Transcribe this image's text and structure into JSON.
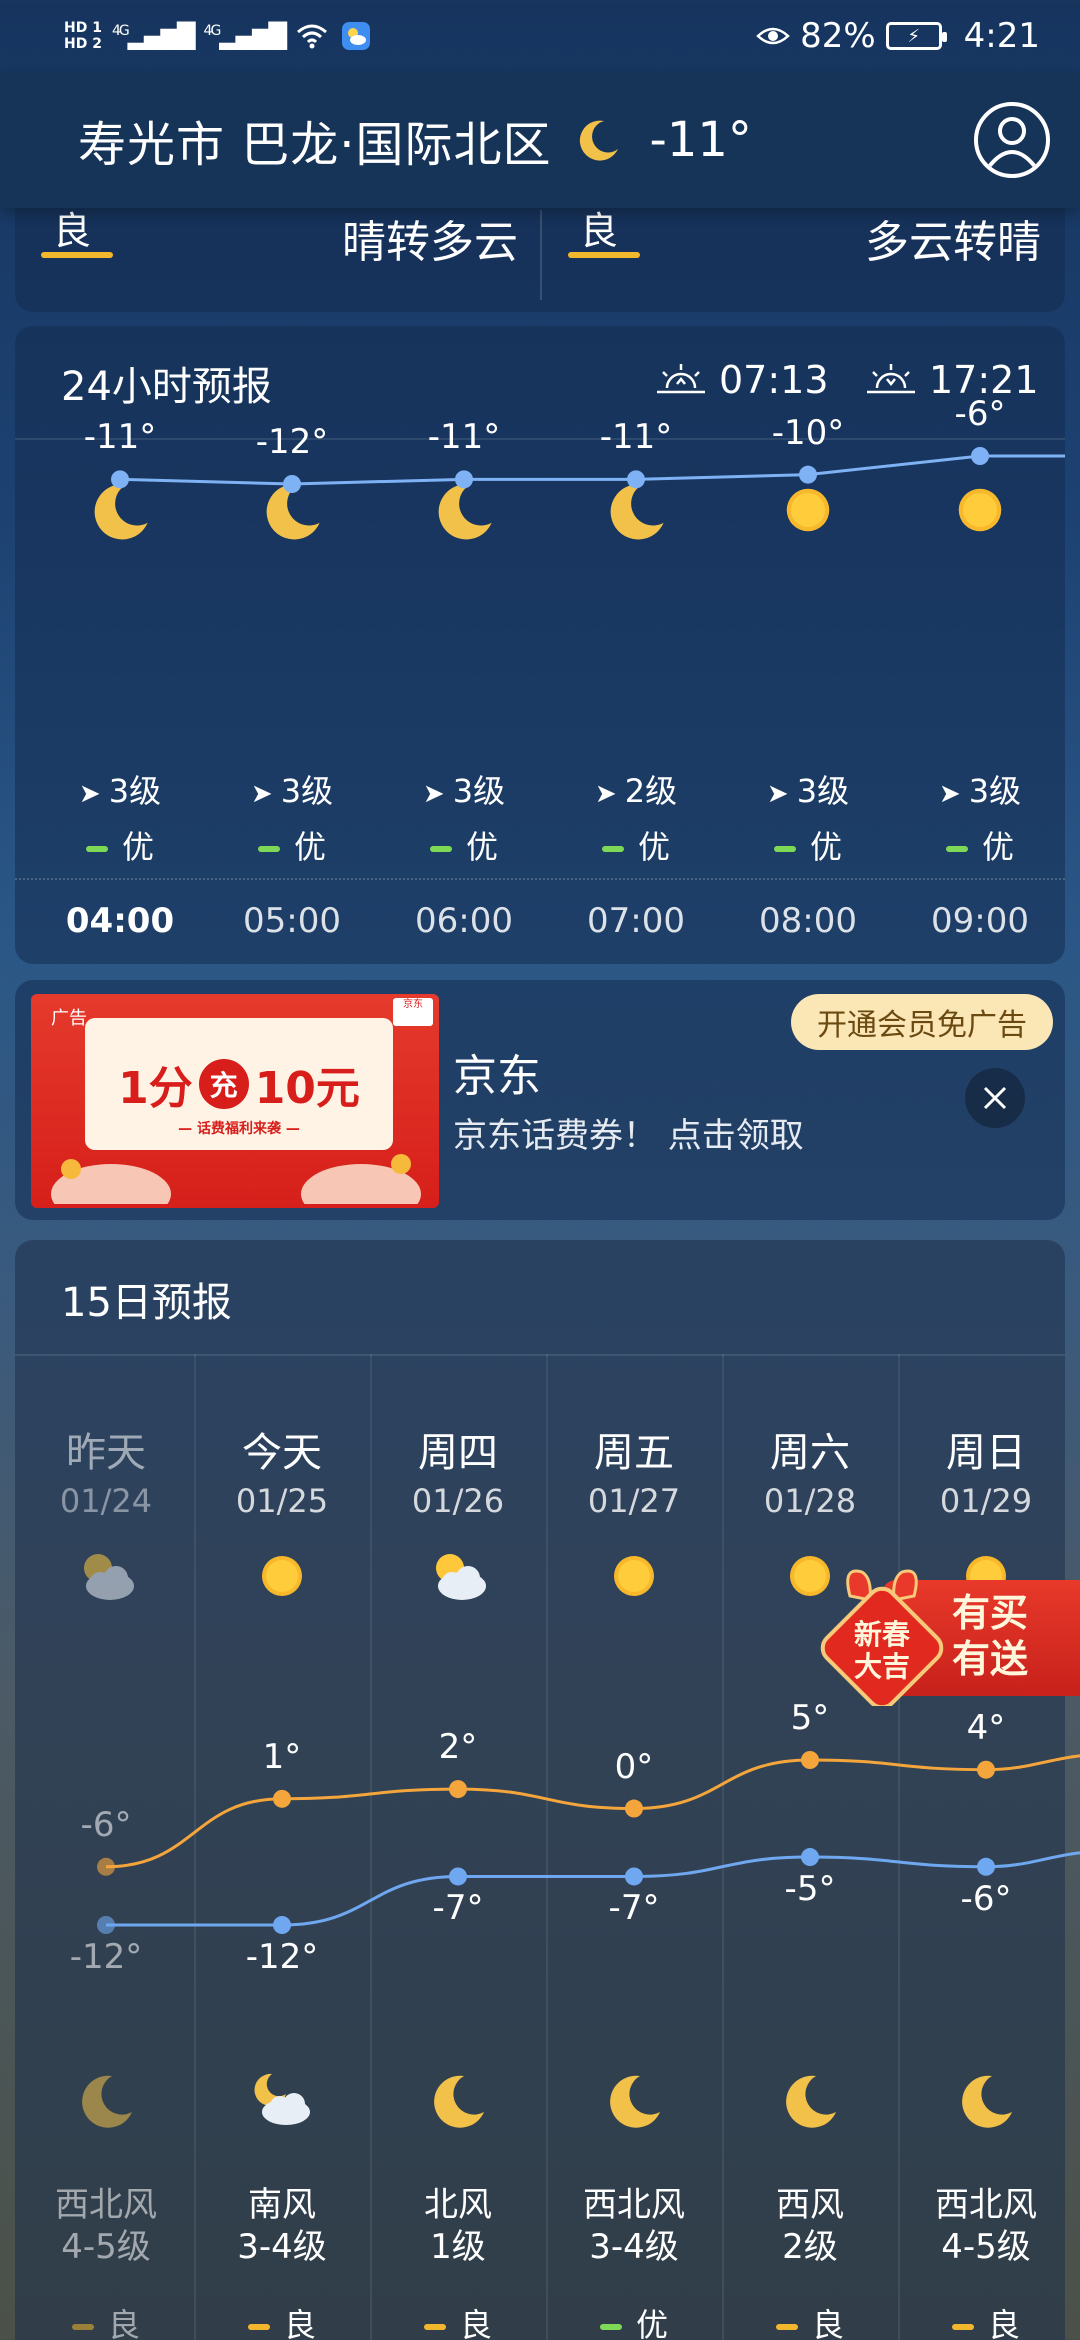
{
  "status_bar": {
    "hd1": "HD 1",
    "hd2": "HD 2",
    "net1": "4G",
    "net2": "4G",
    "battery_percent": "82%",
    "time": "4:21"
  },
  "header": {
    "location": "寿光市 巴龙·国际北区",
    "current_temp": "-11°",
    "icon": "moon-icon"
  },
  "top_card": {
    "left": {
      "aqi": "良",
      "condition": "晴转多云"
    },
    "right": {
      "aqi": "良",
      "condition": "多云转晴"
    }
  },
  "hourly": {
    "title": "24小时预报",
    "sunrise": "07:13",
    "sunset": "17:21",
    "hours": [
      {
        "time": "04:00",
        "icon": "moon-icon",
        "temp": "-11°",
        "wind": "3级",
        "aqi": "优",
        "current": true
      },
      {
        "time": "05:00",
        "icon": "moon-icon",
        "temp": "-12°",
        "wind": "3级",
        "aqi": "优"
      },
      {
        "time": "06:00",
        "icon": "moon-icon",
        "temp": "-11°",
        "wind": "3级",
        "aqi": "优"
      },
      {
        "time": "07:00",
        "icon": "moon-icon",
        "temp": "-11°",
        "wind": "2级",
        "aqi": "优"
      },
      {
        "time": "08:00",
        "icon": "sun-icon",
        "temp": "-10°",
        "wind": "3级",
        "aqi": "优"
      },
      {
        "time": "09:00",
        "icon": "sun-icon",
        "temp": "-6°",
        "wind": "3级",
        "aqi": "优"
      }
    ]
  },
  "ad": {
    "brand": "京东",
    "description": "京东话费券！ 点击领取",
    "vip_button": "开通会员免广告",
    "image_text_a": "1分",
    "image_text_b": "充",
    "image_text_c": "10元",
    "image_sub": "— 话费福利来袭 —",
    "image_logo": "广告",
    "image_jd": "京东"
  },
  "daily": {
    "title": "15日预报",
    "days": [
      {
        "day": "昨天",
        "date": "01/24",
        "day_icon": "partly-cloudy-icon",
        "high": "-6°",
        "low": "-12°",
        "night_icon": "moon-icon",
        "wind_dir": "西北风",
        "wind_level": "4-5级",
        "aqi": "良",
        "past": true
      },
      {
        "day": "今天",
        "date": "01/25",
        "day_icon": "sun-icon",
        "high": "1°",
        "low": "-12°",
        "night_icon": "moon-cloud-icon",
        "wind_dir": "南风",
        "wind_level": "3-4级",
        "aqi": "良"
      },
      {
        "day": "周四",
        "date": "01/26",
        "day_icon": "partly-cloudy-icon",
        "high": "2°",
        "low": "-7°",
        "night_icon": "moon-icon",
        "wind_dir": "北风",
        "wind_level": "1级",
        "aqi": "良"
      },
      {
        "day": "周五",
        "date": "01/27",
        "day_icon": "sun-icon",
        "high": "0°",
        "low": "-7°",
        "night_icon": "moon-icon",
        "wind_dir": "西北风",
        "wind_level": "3-4级",
        "aqi": "优"
      },
      {
        "day": "周六",
        "date": "01/28",
        "day_icon": "sun-icon",
        "high": "5°",
        "low": "-5°",
        "night_icon": "moon-icon",
        "wind_dir": "西风",
        "wind_level": "2级",
        "aqi": "良"
      },
      {
        "day": "周日",
        "date": "01/29",
        "day_icon": "sun-icon",
        "high": "4°",
        "low": "-6°",
        "night_icon": "moon-icon",
        "wind_dir": "西北风",
        "wind_level": "4-5级",
        "aqi": "良"
      }
    ]
  },
  "promo": {
    "badge_line1": "新春",
    "badge_line2": "大吉",
    "text_line1": "有买",
    "text_line2": "有送"
  },
  "colors": {
    "aqi_good": "#f3b72e",
    "aqi_excellent": "#7ed957",
    "high_line": "#f4a53c",
    "low_line": "#6fa8f0",
    "hourly_line": "#7fb2f5"
  }
}
